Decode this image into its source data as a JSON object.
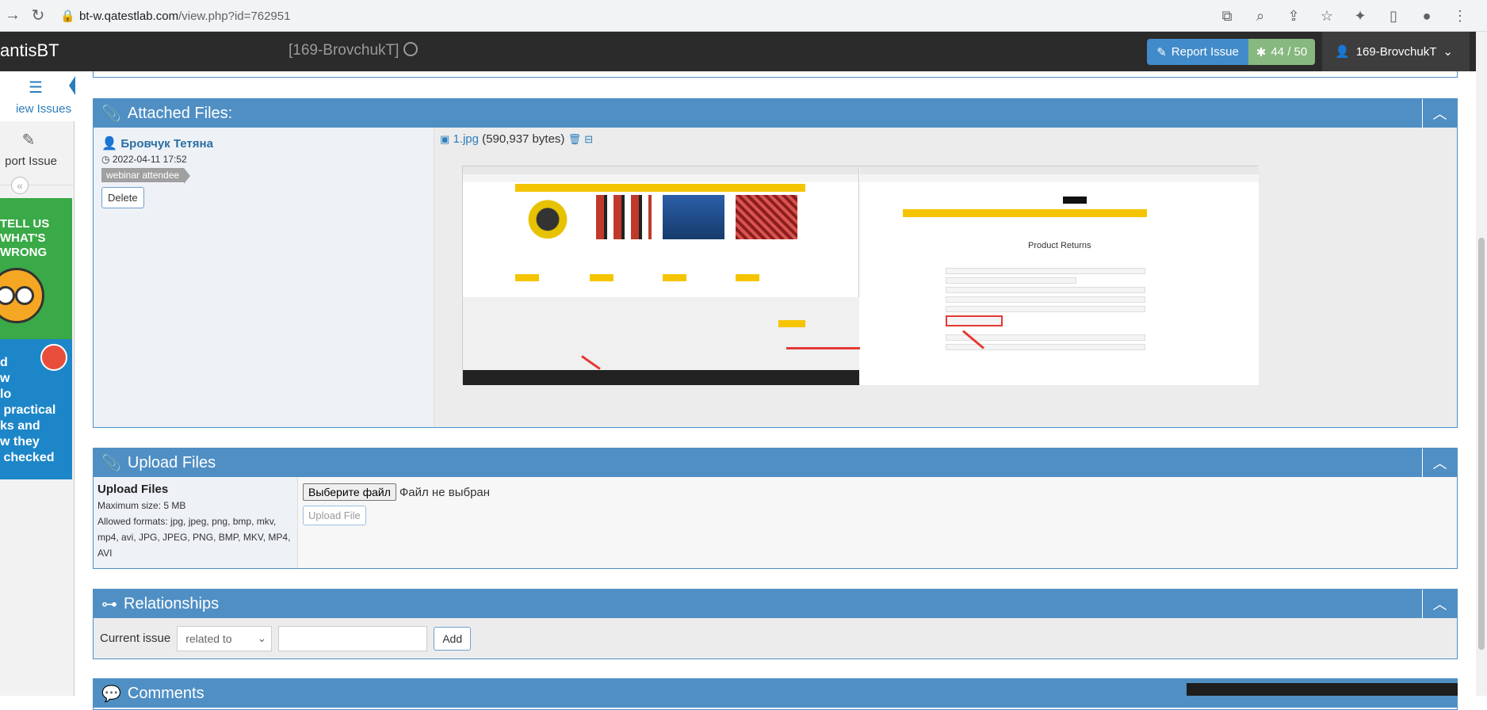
{
  "browser": {
    "url_host": "bt-w.qatestlab.com",
    "url_path": "/view.php?id=762951"
  },
  "navbar": {
    "brand": "antisBT",
    "project": "[169-BrovchukT]",
    "report_issue": "Report Issue",
    "count": "44 / 50",
    "user": "169-BrovchukT"
  },
  "sidebar": {
    "view_issues": "iew Issues",
    "report_issue": "port Issue",
    "ad1_text": "TELL US\nWHAT'S\nWRONG",
    "ad2_text": "d\nw\nlo\n practical\nks and\nw they\n checked"
  },
  "attached": {
    "title": "Attached Files:",
    "author": "Бровчук Тетяна",
    "date": "2022-04-11 17:52",
    "tag": "webinar attendee",
    "delete": "Delete",
    "file_name": "1.jpg",
    "file_size": "(590,937 bytes)",
    "preview_title": "Product Returns"
  },
  "upload": {
    "title": "Upload Files",
    "label": "Upload Files",
    "max_size": "Maximum size: 5 MB",
    "formats": "Allowed formats: jpg, jpeg, png, bmp, mkv, mp4, avi, JPG, JPEG, PNG, BMP, MKV, MP4, AVI",
    "choose_file": "Выберите файл",
    "no_file": "Файл не выбран",
    "upload_btn": "Upload File"
  },
  "relationships": {
    "title": "Relationships",
    "label": "Current issue",
    "select_value": "related to",
    "add": "Add"
  },
  "comments": {
    "title": "Comments"
  },
  "colors": {
    "widget_header": "#4f8fc4",
    "navbar": "#2b2b2b",
    "report_button": "#428bca",
    "count_button": "#87b87f"
  }
}
